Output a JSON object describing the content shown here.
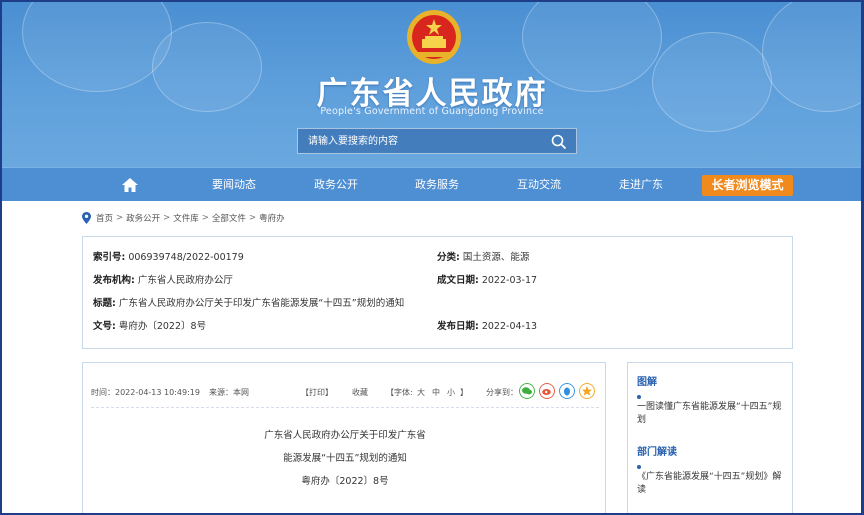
{
  "header": {
    "site_title": "广东省人民政府",
    "site_subtitle": "People's Government of Guangdong Province",
    "search_placeholder": "请输入要搜索的内容"
  },
  "nav": {
    "items": [
      {
        "label": "要闻动态"
      },
      {
        "label": "政务公开"
      },
      {
        "label": "政务服务"
      },
      {
        "label": "互动交流"
      },
      {
        "label": "走进广东"
      }
    ],
    "elder_mode": "长者浏览模式"
  },
  "breadcrumb": [
    "首页",
    "政务公开",
    "文件库",
    "全部文件",
    "粤府办"
  ],
  "meta": {
    "index_key": "索引号:",
    "index_value": "006939748/2022-00179",
    "category_key": "分类:",
    "category_value": "国土资源、能源",
    "publisher_key": "发布机构:",
    "publisher_value": "广东省人民政府办公厅",
    "created_key": "成文日期:",
    "created_value": "2022-03-17",
    "title_key": "标题:",
    "title_value": "广东省人民政府办公厅关于印发广东省能源发展“十四五”规划的通知",
    "docno_key": "文号:",
    "docno_value": "粤府办〔2022〕8号",
    "published_key": "发布日期:",
    "published_value": "2022-04-13"
  },
  "article": {
    "time": "时间：2022-04-13 10:49:19",
    "source": "来源：本网",
    "print": "【打印】",
    "favorite": "收藏",
    "font_open": "【字体:",
    "font_large": "大",
    "font_medium": "中",
    "font_small": "小",
    "font_close": "】",
    "share": "分享到：",
    "title_line1": "广东省人民政府办公厅关于印发广东省",
    "title_line2": "能源发展“十四五”规划的通知",
    "doc_number": "粤府办〔2022〕8号"
  },
  "side": {
    "section1_title": "图解",
    "section1_link": "一图读懂广东省能源发展“十四五”规划",
    "section2_title": "部门解读",
    "section2_link": "《广东省能源发展“十四五”规划》解读"
  },
  "colors": {
    "banner": "#5fa0dc",
    "nav": "#4e8fd3",
    "elder_button": "#f08a1c",
    "link_blue": "#2a62b0"
  }
}
